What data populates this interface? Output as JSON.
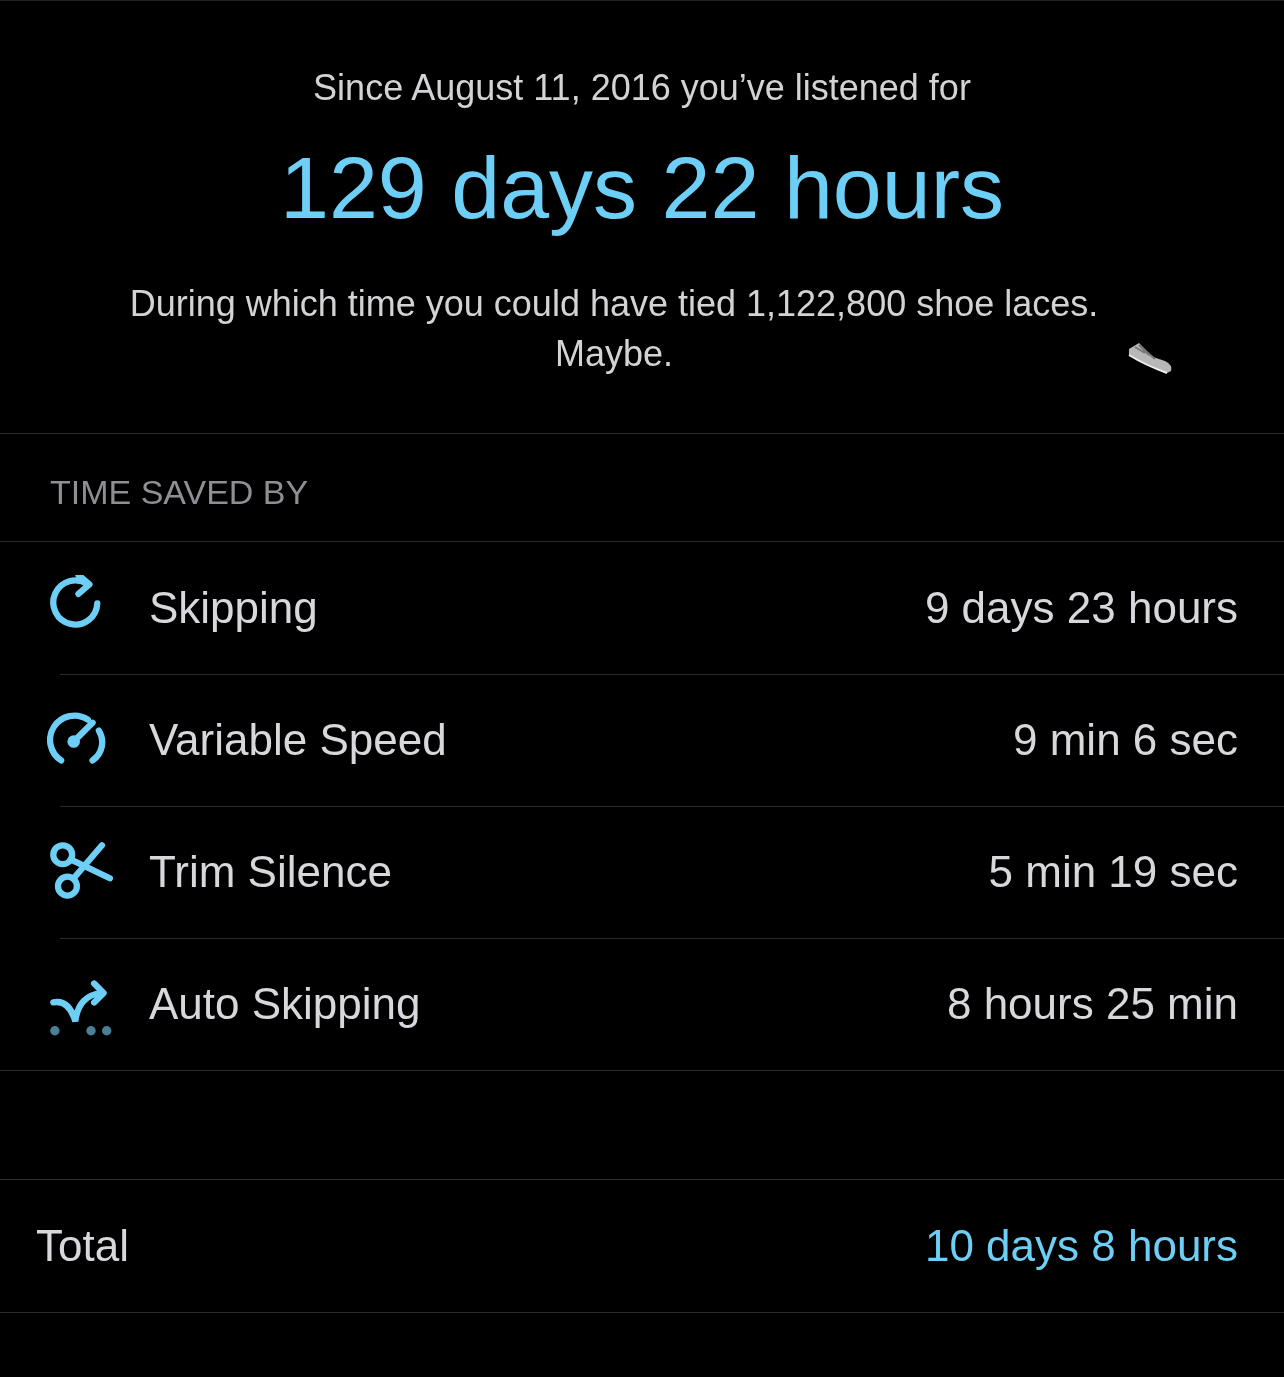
{
  "summary": {
    "intro": "Since August 11, 2016 you’ve listened for",
    "total_listened": "129 days 22 hours",
    "fun_fact": "During which time you could have tied 1,122,800 shoe laces. Maybe."
  },
  "time_saved": {
    "header": "TIME SAVED BY",
    "rows": [
      {
        "kind": "skip",
        "label": "Skipping",
        "value": "9 days 23 hours"
      },
      {
        "kind": "speed",
        "label": "Variable Speed",
        "value": "9 min 6 sec"
      },
      {
        "kind": "trim",
        "label": "Trim Silence",
        "value": "5 min 19 sec"
      },
      {
        "kind": "autoskip",
        "label": "Auto Skipping",
        "value": "8 hours 25 min"
      }
    ]
  },
  "total": {
    "label": "Total",
    "value": "10 days 8 hours"
  }
}
